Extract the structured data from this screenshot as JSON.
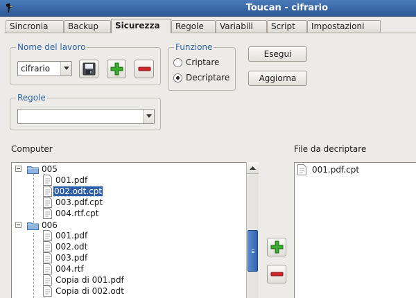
{
  "window": {
    "title": "Toucan - cifrario"
  },
  "tabs": [
    {
      "label": "Sincronia"
    },
    {
      "label": "Backup"
    },
    {
      "label": "Sicurezza",
      "active": true
    },
    {
      "label": "Regole"
    },
    {
      "label": "Variabili"
    },
    {
      "label": "Script"
    },
    {
      "label": "Impostazioni"
    }
  ],
  "job_group": {
    "legend": "Nome del lavoro",
    "job_value": "cifrario"
  },
  "function_group": {
    "legend": "Funzione",
    "options": [
      {
        "label": "Criptare",
        "selected": false
      },
      {
        "label": "Decriptare",
        "selected": true
      }
    ]
  },
  "buttons": {
    "run": "Esegui",
    "refresh": "Aggiorna"
  },
  "rules_group": {
    "legend": "Regole",
    "value": ""
  },
  "computer": {
    "label": "Computer",
    "tree": [
      {
        "label": "005",
        "type": "folder"
      },
      {
        "label": "001.pdf",
        "type": "file"
      },
      {
        "label": "002.odt.cpt",
        "type": "file",
        "selected": true
      },
      {
        "label": "003.pdf.cpt",
        "type": "file"
      },
      {
        "label": "004.rtf.cpt",
        "type": "file"
      },
      {
        "label": "006",
        "type": "folder"
      },
      {
        "label": "001.pdf",
        "type": "file"
      },
      {
        "label": "002.odt",
        "type": "file"
      },
      {
        "label": "003.pdf",
        "type": "file"
      },
      {
        "label": "004.rtf",
        "type": "file"
      },
      {
        "label": "Copia di 001.pdf",
        "type": "file"
      },
      {
        "label": "Copia di 002.odt",
        "type": "file"
      }
    ]
  },
  "decrypt": {
    "label": "File da decriptare",
    "files": [
      "001.pdf.cpt"
    ]
  },
  "colors": {
    "accent": "#2f5fa6",
    "titlebar": "#2c5a97",
    "add": "#3aa82c",
    "remove": "#d0262a"
  },
  "icons": [
    "app-icon",
    "save-icon",
    "add-icon",
    "remove-icon",
    "folder-icon",
    "file-icon",
    "chevron-down-icon"
  ]
}
